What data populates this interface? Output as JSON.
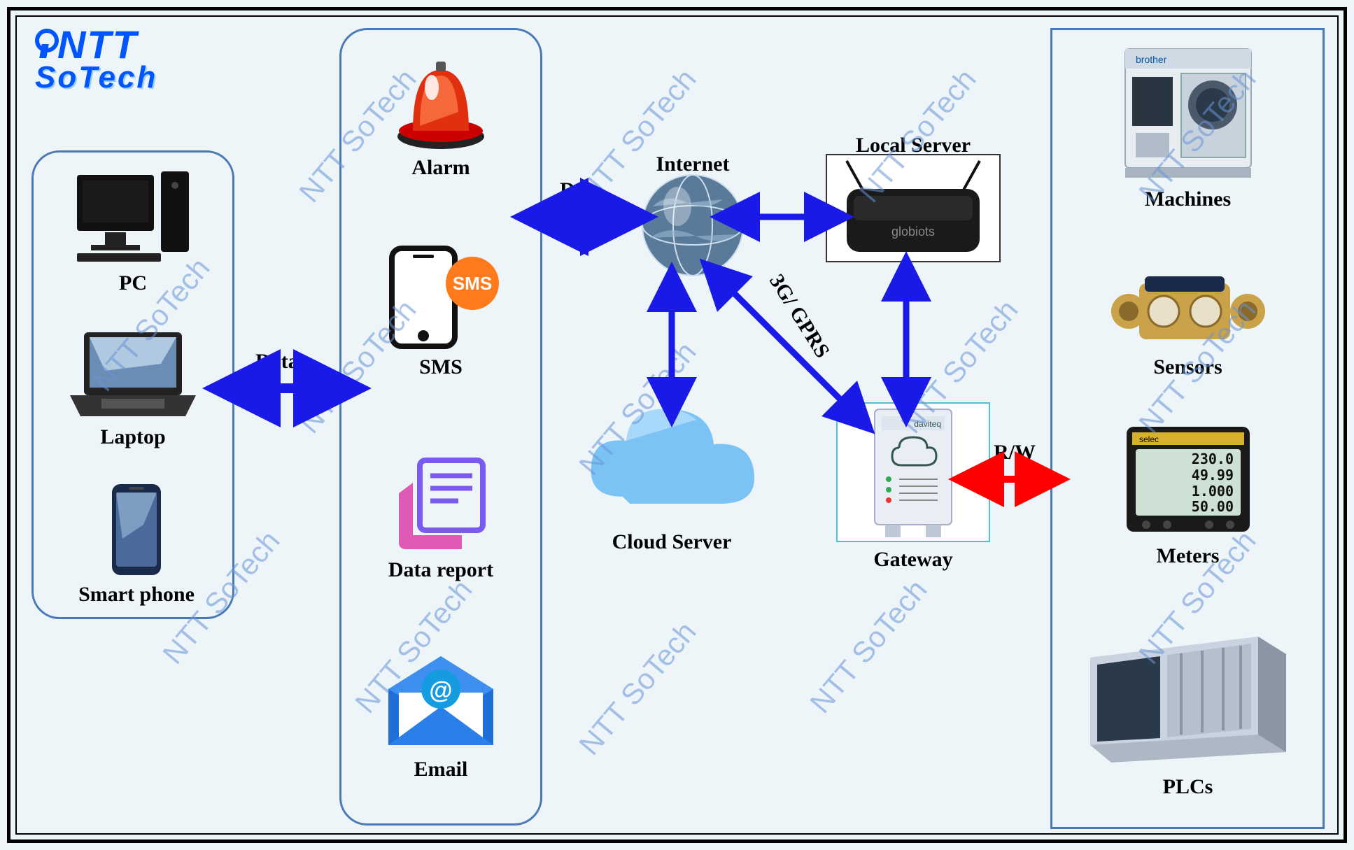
{
  "logo": {
    "top": "NTT",
    "bottom": "SoTech"
  },
  "watermark": "NTT SoTech",
  "clients": {
    "pc": "PC",
    "laptop": "Laptop",
    "smartphone": "Smart phone"
  },
  "services": {
    "alarm": "Alarm",
    "sms": "SMS",
    "datareport": "Data report",
    "email": "Email"
  },
  "network": {
    "internet": "Internet",
    "localserver": "Local Server",
    "cloud": "Cloud Server",
    "gateway": "Gateway"
  },
  "devices": {
    "machines": "Machines",
    "sensors": "Sensors",
    "meters": "Meters",
    "plcs": "PLCs"
  },
  "arrows": {
    "data1": "Data",
    "data2": "Data",
    "gprs": "3G/ GPRS",
    "rw": "R/W"
  },
  "colors": {
    "arrow_blue": "#1a1ae8",
    "arrow_red": "#ff0000",
    "border_blue": "#4a7ab5"
  }
}
